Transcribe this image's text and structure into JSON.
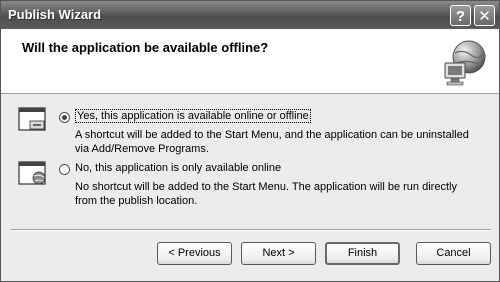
{
  "window": {
    "title": "Publish Wizard",
    "help_glyph": "?",
    "close_glyph": "✕"
  },
  "header": {
    "question": "Will the application be available offline?",
    "icon": "globe-computer-icon"
  },
  "options": [
    {
      "label": "Yes, this application is available online or offline",
      "selected": true,
      "icon": "start-menu-shortcut-icon",
      "description_lines": [
        "A shortcut will be added to the Start Menu, and the application can be uninstalled",
        "via Add/Remove Programs."
      ]
    },
    {
      "label": "No, this application is only available online",
      "selected": false,
      "icon": "web-browser-icon",
      "description_lines": [
        "No shortcut will be added to the Start Menu. The application will be run directly",
        "from the publish location."
      ]
    }
  ],
  "buttons": {
    "previous": "< Previous",
    "next": "Next >",
    "finish": "Finish",
    "cancel": "Cancel"
  }
}
